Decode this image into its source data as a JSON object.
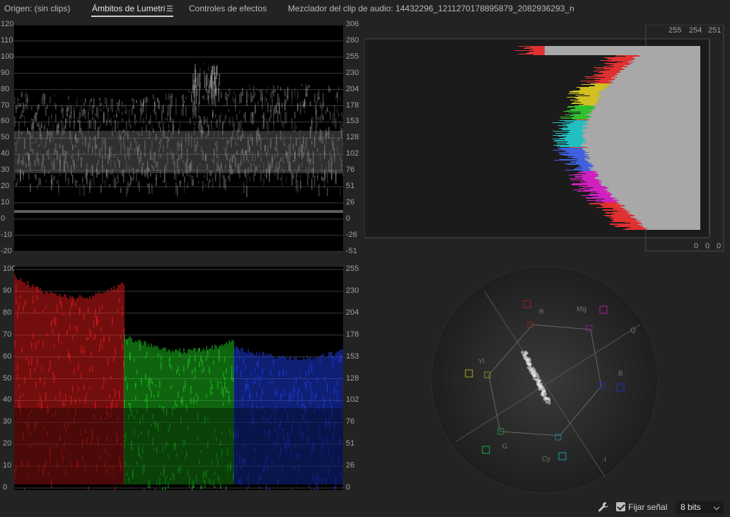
{
  "tabs": [
    {
      "label": "Origen: (sin clips)"
    },
    {
      "label": "Ámbitos de Lumetri"
    },
    {
      "label": "Controles de efectos"
    },
    {
      "label": "Mezclador del clip de audio: 14432296_1211270178895879_2082936293_n"
    }
  ],
  "waveform": {
    "left_ticks": [
      "120",
      "110",
      "100",
      "90",
      "80",
      "70",
      "60",
      "50",
      "40",
      "30",
      "20",
      "10",
      "0",
      "-10",
      "-20"
    ],
    "right_ticks": [
      "306",
      "280",
      "255",
      "230",
      "204",
      "178",
      "153",
      "128",
      "102",
      "76",
      "51",
      "26",
      "0",
      "-26",
      "-51"
    ]
  },
  "parade": {
    "left_ticks": [
      "100",
      "90",
      "80",
      "70",
      "60",
      "50",
      "40",
      "30",
      "20",
      "10",
      "0"
    ],
    "right_ticks": [
      "255",
      "230",
      "204",
      "178",
      "153",
      "128",
      "102",
      "76",
      "51",
      "26",
      "0"
    ],
    "colors": [
      "#ff2020",
      "#22e022",
      "#2244ff"
    ]
  },
  "histogram": {
    "top_values": {
      "r": "255",
      "g": "254",
      "b": "251"
    },
    "bottom_values": {
      "r": "0",
      "g": "0",
      "b": "0"
    },
    "colors": {
      "r": "#e03030",
      "g": "#30c030",
      "b": "#4060e0"
    }
  },
  "vectorscope": {
    "labels": {
      "r": "R",
      "mg": "Mg",
      "q": "Q",
      "yl": "Yl",
      "b": "B",
      "g": "G",
      "cy": "Cy",
      "i": "-I"
    }
  },
  "footer": {
    "lock_label": "Fijar señal",
    "bit_depth": "8 bits"
  }
}
